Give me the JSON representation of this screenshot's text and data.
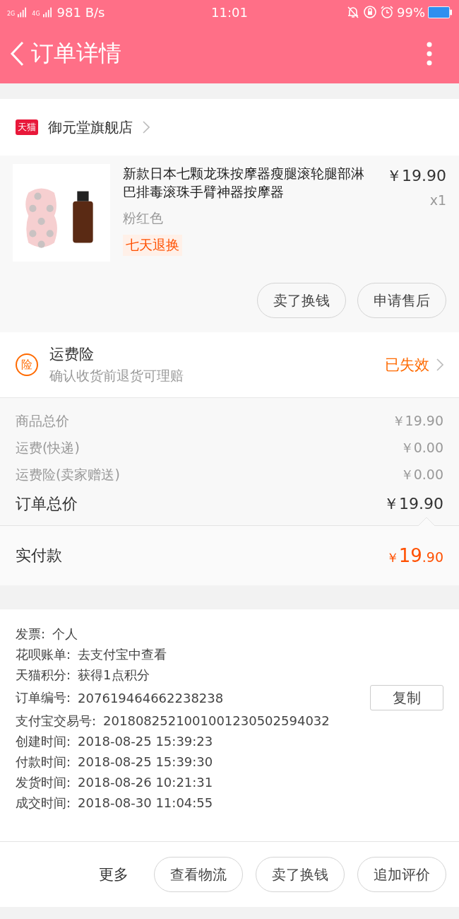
{
  "status_bar": {
    "signal_1": "2G",
    "signal_2": "4G",
    "speed": "981 B/s",
    "time": "11:01",
    "battery": "99%"
  },
  "header": {
    "title": "订单详情"
  },
  "store": {
    "badge": "天猫",
    "name": "御元堂旗舰店"
  },
  "product": {
    "image": {
      "kind": "picture"
    },
    "title": "新款日本七颗龙珠按摩器瘦腿滚轮腿部淋巴排毒滚珠手臂神器按摩器",
    "variant": "粉红色",
    "tag": "七天退换",
    "price": "￥19.90",
    "quantity": "x1",
    "buttons": [
      "卖了换钱",
      "申请售后"
    ]
  },
  "insurance": {
    "icon": "险",
    "title": "运费险",
    "subtitle": "确认收货前退货可理赔",
    "status": "已失效"
  },
  "costs": [
    {
      "label": "商品总价",
      "value": "￥19.90"
    },
    {
      "label": "运费(快递)",
      "value": "￥0.00"
    },
    {
      "label": "运费险(卖家赠送)",
      "value": "￥0.00"
    }
  ],
  "total": {
    "label": "订单总价",
    "value": "￥19.90"
  },
  "paid": {
    "label": "实付款",
    "currency": "￥",
    "integer": "19",
    "decimal": ".90"
  },
  "info": [
    {
      "label": "发票:",
      "value": "个人"
    },
    {
      "label": "花呗账单:",
      "value": "去支付宝中查看"
    },
    {
      "label": "天猫积分:",
      "value": "获得1点积分"
    },
    {
      "label": "订单编号:",
      "value": "207619464662238238",
      "action": "复制"
    },
    {
      "label": "支付宝交易号:",
      "value": "2018082521001001230502594032"
    },
    {
      "label": "创建时间:",
      "value": "2018-08-25 15:39:23"
    },
    {
      "label": "付款时间:",
      "value": "2018-08-25 15:39:30"
    },
    {
      "label": "发货时间:",
      "value": "2018-08-26 10:21:31"
    },
    {
      "label": "成交时间:",
      "value": "2018-08-30 11:04:55"
    }
  ],
  "bottom_bar": {
    "more": "更多",
    "buttons": [
      "查看物流",
      "卖了换钱",
      "追加评价"
    ]
  }
}
